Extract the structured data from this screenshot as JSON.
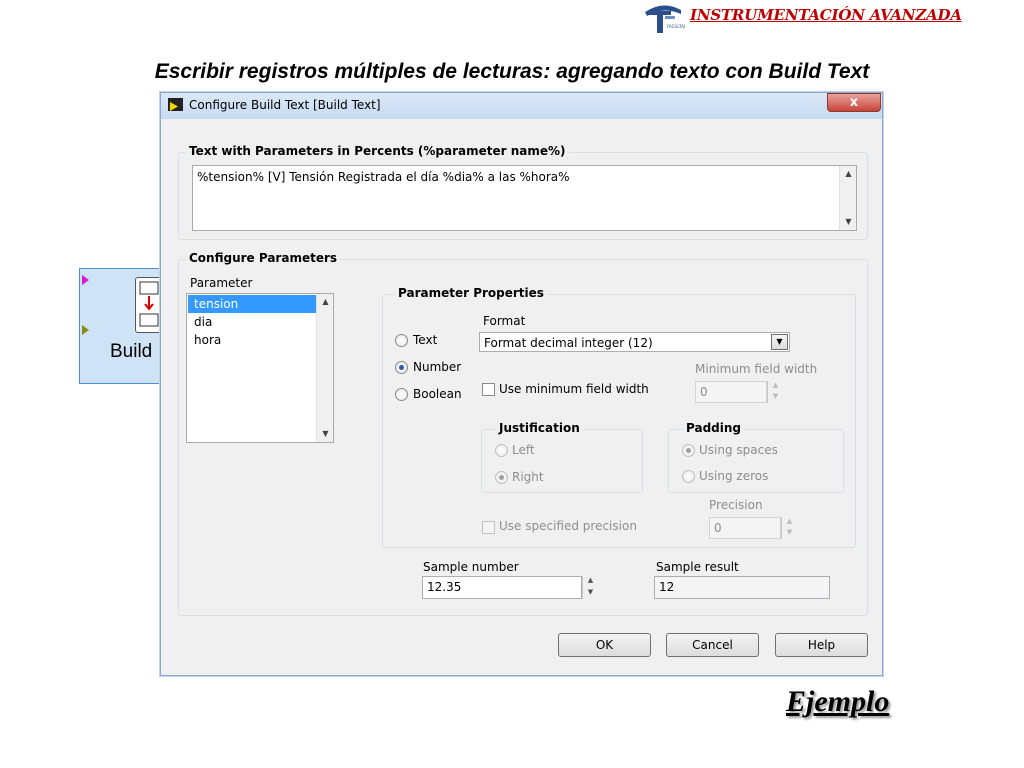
{
  "header": {
    "brand": "INSTRUMENTACIÓN AVANZADA",
    "slide_title": "Escribir registros múltiples de lecturas: agregando texto con Build Text",
    "footer_label": "Ejemplo"
  },
  "node": {
    "label": "Build"
  },
  "dialog": {
    "title": "Configure Build Text [Build Text]",
    "close_label": "x",
    "text_group": {
      "label": "Text with Parameters in Percents (%parameter name%)",
      "value": "%tension% [V] Tensión Registrada el día %dia% a las %hora%"
    },
    "params_group": {
      "label": "Configure Parameters",
      "parameter_label": "Parameter",
      "parameters": [
        "tension",
        "dia",
        "hora"
      ],
      "selected_index": 0
    },
    "properties": {
      "label": "Parameter Properties",
      "types": [
        "Text",
        "Number",
        "Boolean"
      ],
      "selected_type": "Number",
      "format_label": "Format",
      "format_value": "Format decimal integer  (12)",
      "use_min_width_label": "Use minimum field width",
      "min_width_label": "Minimum field width",
      "min_width_value": "0",
      "justification": {
        "label": "Justification",
        "options": [
          "Left",
          "Right"
        ],
        "selected": "Right"
      },
      "padding": {
        "label": "Padding",
        "options": [
          "Using spaces",
          "Using zeros"
        ],
        "selected": "Using spaces"
      },
      "precision_label": "Precision",
      "precision_value": "0",
      "use_precision_label": "Use specified precision"
    },
    "sample": {
      "number_label": "Sample number",
      "number_value": "12.35",
      "result_label": "Sample result",
      "result_value": "12"
    },
    "buttons": {
      "ok": "OK",
      "cancel": "Cancel",
      "help": "Help"
    }
  },
  "colors": {
    "brand": "#c00000",
    "selection": "#3399ff",
    "titlebar": "#c7daf1"
  },
  "icons": [
    "logo-icon",
    "labview-icon",
    "close-icon",
    "scroll-up-icon",
    "scroll-down-icon",
    "dropdown-arrow-icon",
    "spin-up-icon",
    "spin-down-icon"
  ]
}
